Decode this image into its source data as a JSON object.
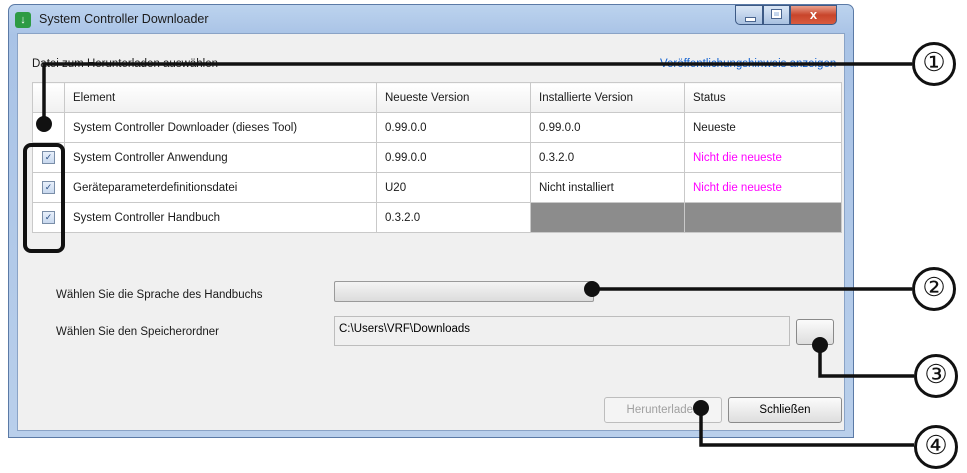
{
  "window": {
    "title": "System Controller Downloader",
    "app_icon": "download-arrow-icon",
    "close_glyph": "x"
  },
  "header": {
    "select_label": "Datei zum Herunterladen auswählen",
    "release_notes_link": "Veröffentlichungshinweis anzeigen"
  },
  "table": {
    "columns": [
      "Element",
      "Neueste Version",
      "Installierte Version",
      "Status"
    ],
    "rows": [
      {
        "checked": false,
        "element": "System Controller Downloader (dieses Tool)",
        "latest": "0.99.0.0",
        "installed": "0.99.0.0",
        "status": "Neueste"
      },
      {
        "checked": true,
        "element": "System Controller Anwendung",
        "latest": "0.99.0.0",
        "installed": "0.3.2.0",
        "status": "Nicht die neueste"
      },
      {
        "checked": true,
        "element": "Geräteparameterdefinitionsdatei",
        "latest": "U20",
        "installed": "Nicht installiert",
        "status": "Nicht die neueste"
      },
      {
        "checked": true,
        "element": "System Controller Handbuch",
        "latest": "0.3.2.0",
        "installed": "",
        "status": ""
      }
    ]
  },
  "language": {
    "label": "Wählen Sie die Sprache des Handbuchs",
    "value": ""
  },
  "folder": {
    "label": "Wählen Sie den Speicherordner",
    "path": "C:\\Users\\VRF\\Downloads"
  },
  "buttons": {
    "download": "Herunterladen",
    "close": "Schließen"
  },
  "callouts": [
    "①",
    "②",
    "③",
    "④"
  ],
  "colors": {
    "status_outdated": "#ff00ff",
    "disabled_cell": "#8c8c8c"
  }
}
